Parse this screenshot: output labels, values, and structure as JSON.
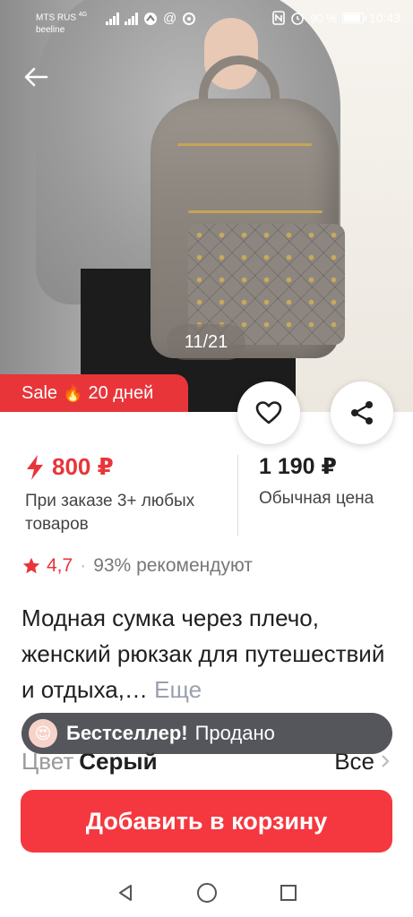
{
  "status_bar": {
    "carrier_top": "MTS RUS",
    "network": "4G",
    "carrier_bottom": "beeline",
    "battery_text": "90 %",
    "battery_level": 0.9,
    "time": "10:43",
    "icons": [
      "signal-icon",
      "signal-icon",
      "app-icon",
      "at-icon",
      "circle-icon",
      "nfc-icon",
      "alarm-icon",
      "battery-icon"
    ]
  },
  "gallery": {
    "counter": "11/21",
    "back_icon": "back-arrow-icon"
  },
  "sale_badge": {
    "label": "Sale",
    "emoji": "🔥",
    "days": "20 дней"
  },
  "actions": {
    "favorite_icon": "heart-icon",
    "share_icon": "share-icon"
  },
  "price": {
    "discount_value": "800 ₽",
    "discount_note": "При заказе 3+ любых товаров",
    "regular_value": "1 190 ₽",
    "regular_note": "Обычная цена",
    "accent_color": "#e8353a"
  },
  "rating": {
    "score": "4,7",
    "separator": "·",
    "recommend": "93% рекомендуют"
  },
  "product": {
    "title": "Модная сумка через плечо, женский рюкзак для путешествий и отдыха,…",
    "more": "Еще"
  },
  "toast": {
    "emoji": "😍",
    "bold": "Бестселлер!",
    "text": "Продано"
  },
  "color_option": {
    "label": "Цвет",
    "value": "Серый",
    "all": "Все"
  },
  "cart_button": {
    "label": "Добавить в корзину",
    "color": "#f5373f"
  },
  "nav": [
    "back-triangle-icon",
    "home-circle-icon",
    "recents-square-icon"
  ]
}
